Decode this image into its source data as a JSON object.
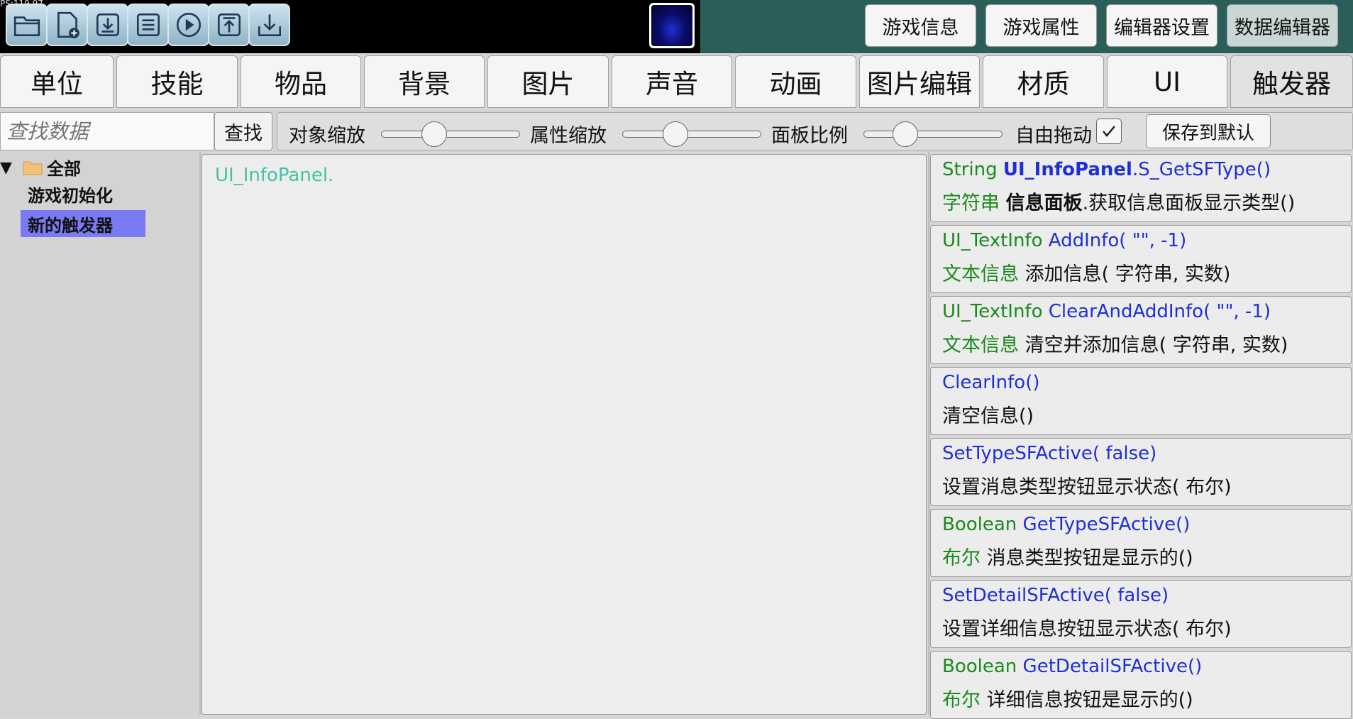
{
  "fps": "PS:119.97",
  "toolbar": {
    "icons": [
      "open-folder-icon",
      "new-file-icon",
      "download-icon",
      "save-icon",
      "play-icon",
      "upload-icon",
      "import-icon"
    ],
    "buttons": [
      "游戏信息",
      "游戏属性",
      "编辑器设置",
      "数据编辑器"
    ]
  },
  "tabs": [
    "单位",
    "技能",
    "物品",
    "背景",
    "图片",
    "声音",
    "动画",
    "图片编辑",
    "材质",
    "UI",
    "触发器"
  ],
  "filter": {
    "search_placeholder": "查找数据",
    "search_button": "查找",
    "object_scale": "对象缩放",
    "attr_scale": "属性缩放",
    "panel_ratio": "面板比例",
    "free_drag": "自由拖动",
    "free_drag_checked": true,
    "save_default": "保存到默认",
    "object_scale_value": 0.35,
    "attr_scale_value": 0.35,
    "panel_ratio_value": 0.25
  },
  "tree": {
    "root": "全部",
    "items": [
      "游戏初始化",
      "新的触发器"
    ]
  },
  "editor": {
    "text": "UI_InfoPanel."
  },
  "methods": [
    {
      "l1": [
        {
          "t": "String ",
          "c": "ret"
        },
        {
          "t": "UI_InfoPanel",
          "c": "fn bold"
        },
        {
          "t": ".S_GetSFType()",
          "c": "fn"
        }
      ],
      "l2": [
        {
          "t": "字符串 ",
          "c": "ret"
        },
        {
          "t": "信息面板",
          "c": "bold"
        },
        {
          "t": ".获取信息面板显示类型()",
          "c": ""
        }
      ]
    },
    {
      "l1": [
        {
          "t": "UI_TextInfo ",
          "c": "ret"
        },
        {
          "t": "AddInfo( \"\", -1)",
          "c": "fn"
        }
      ],
      "l2": [
        {
          "t": "文本信息 ",
          "c": "ret"
        },
        {
          "t": "添加信息( 字符串, 实数)",
          "c": ""
        }
      ]
    },
    {
      "l1": [
        {
          "t": "UI_TextInfo ",
          "c": "ret"
        },
        {
          "t": "ClearAndAddInfo( \"\", -1)",
          "c": "fn"
        }
      ],
      "l2": [
        {
          "t": "文本信息 ",
          "c": "ret"
        },
        {
          "t": "清空并添加信息( 字符串, 实数)",
          "c": ""
        }
      ]
    },
    {
      "l1": [
        {
          "t": "ClearInfo()",
          "c": "fn"
        }
      ],
      "l2": [
        {
          "t": "清空信息()",
          "c": ""
        }
      ]
    },
    {
      "l1": [
        {
          "t": "SetTypeSFActive( false)",
          "c": "fn"
        }
      ],
      "l2": [
        {
          "t": "设置消息类型按钮显示状态( 布尔)",
          "c": ""
        }
      ]
    },
    {
      "l1": [
        {
          "t": "Boolean ",
          "c": "ret"
        },
        {
          "t": "GetTypeSFActive()",
          "c": "fn"
        }
      ],
      "l2": [
        {
          "t": "布尔 ",
          "c": "ret"
        },
        {
          "t": "消息类型按钮是显示的()",
          "c": ""
        }
      ]
    },
    {
      "l1": [
        {
          "t": "SetDetailSFActive( false)",
          "c": "fn"
        }
      ],
      "l2": [
        {
          "t": "设置详细信息按钮显示状态( 布尔)",
          "c": ""
        }
      ]
    },
    {
      "l1": [
        {
          "t": "Boolean ",
          "c": "ret"
        },
        {
          "t": "GetDetailSFActive()",
          "c": "fn"
        }
      ],
      "l2": [
        {
          "t": "布尔 ",
          "c": "ret"
        },
        {
          "t": "详细信息按钮是显示的()",
          "c": ""
        }
      ]
    }
  ]
}
